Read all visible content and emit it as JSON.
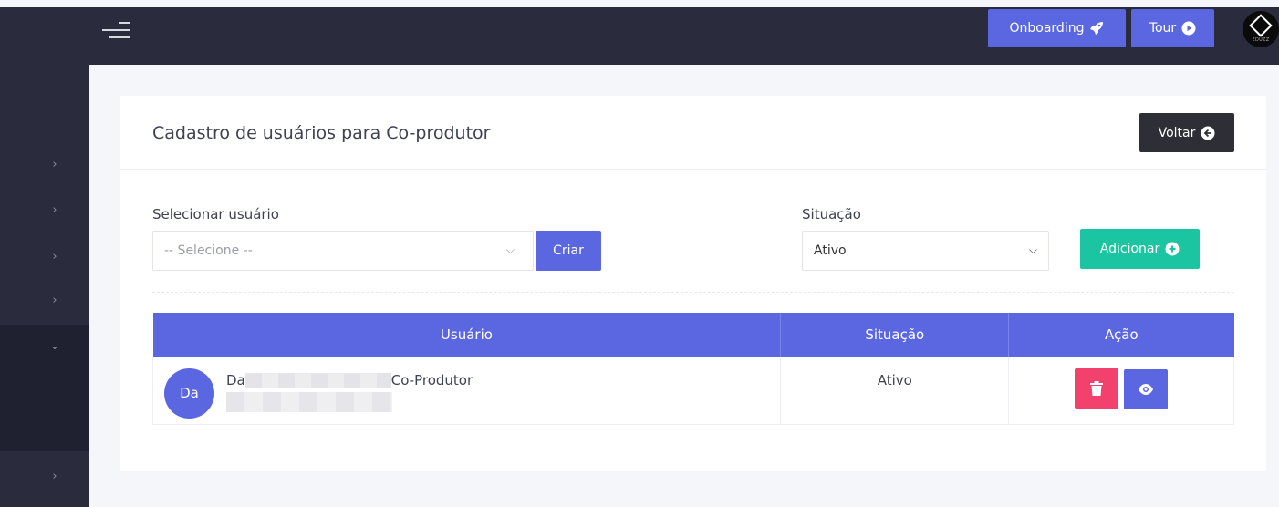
{
  "topbar": {
    "onboarding_label": "Onboarding",
    "tour_label": "Tour",
    "logo_text": "EDUZZ"
  },
  "card": {
    "title": "Cadastro de usuários para Co-produtor",
    "back_label": "Voltar"
  },
  "form": {
    "user_label": "Selecionar usuário",
    "user_placeholder": "-- Selecione --",
    "create_label": "Criar",
    "status_label": "Situação",
    "status_value": "Ativo",
    "add_label": "Adicionar"
  },
  "table": {
    "headers": [
      "Usuário",
      "Situação",
      "Ação"
    ],
    "rows": [
      {
        "avatar": "Da",
        "name_prefix": "Da",
        "name_suffix": "Co-Produtor",
        "status": "Ativo"
      }
    ]
  },
  "colors": {
    "primary": "#5a67e0",
    "success": "#1bc5a1",
    "danger": "#f1416c",
    "dark": "#2a2b3c"
  }
}
